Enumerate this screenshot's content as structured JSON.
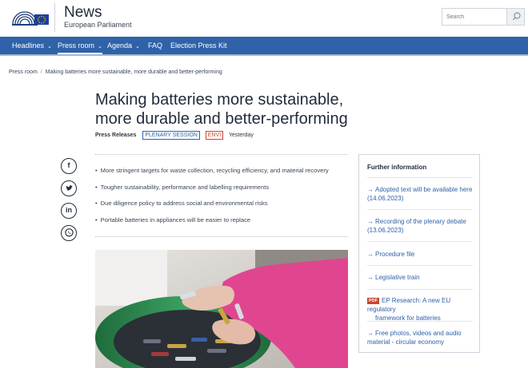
{
  "header": {
    "title": "News",
    "subtitle": "European Parliament",
    "logo_icon": "european-parliament-logo-icon"
  },
  "search": {
    "placeholder": "Search",
    "icon": "search-icon"
  },
  "nav": {
    "items": [
      {
        "label": "Headlines",
        "has_dropdown": true
      },
      {
        "label": "Press room",
        "has_dropdown": true,
        "active": true
      },
      {
        "label": "Agenda",
        "has_dropdown": true
      },
      {
        "label": "FAQ",
        "has_dropdown": false
      },
      {
        "label": "Election Press Kit",
        "has_dropdown": false
      }
    ]
  },
  "breadcrumb": {
    "items": [
      "Press room",
      "Making batteries more sustainable, more durable and better-performing"
    ]
  },
  "article": {
    "title_line1": "Making batteries more sustainable,",
    "title_line2": "more durable and better-performing",
    "type": "Press Releases",
    "tag_session": "PLENARY SESSION",
    "tag_committee": "ENVI",
    "date": "Yesterday",
    "bullets": [
      "More stringent targets for waste collection, recycling efficiency, and material recovery",
      "Tougher sustainability, performance and labelling requirements",
      "Due diligence policy to address social and environmental risks",
      "Portable batteries in appliances will be easier to replace"
    ]
  },
  "share": {
    "facebook": "f",
    "linkedin": "in"
  },
  "further": {
    "title": "Further information",
    "items": [
      {
        "line1": "Adopted text will be available here",
        "line2": "(14.06.2023)"
      },
      {
        "line1": "Recording of the plenary debate",
        "line2": "(13.06.2023)"
      },
      {
        "line1": "Procedure file",
        "line2": ""
      },
      {
        "line1": "Legislative train",
        "line2": ""
      },
      {
        "badge": "PDF",
        "line1": "EP Research: A new EU regulatory",
        "line2": "framework for batteries"
      },
      {
        "line1": "Free photos, videos and audio",
        "line2": "material - circular economy"
      }
    ]
  },
  "colors": {
    "nav_blue": "#2f62a8",
    "title_dark": "#1f2b3a",
    "tag_red": "#c8462e",
    "glove_pink": "#e0468f",
    "bin_green": "#2f8a4f"
  }
}
